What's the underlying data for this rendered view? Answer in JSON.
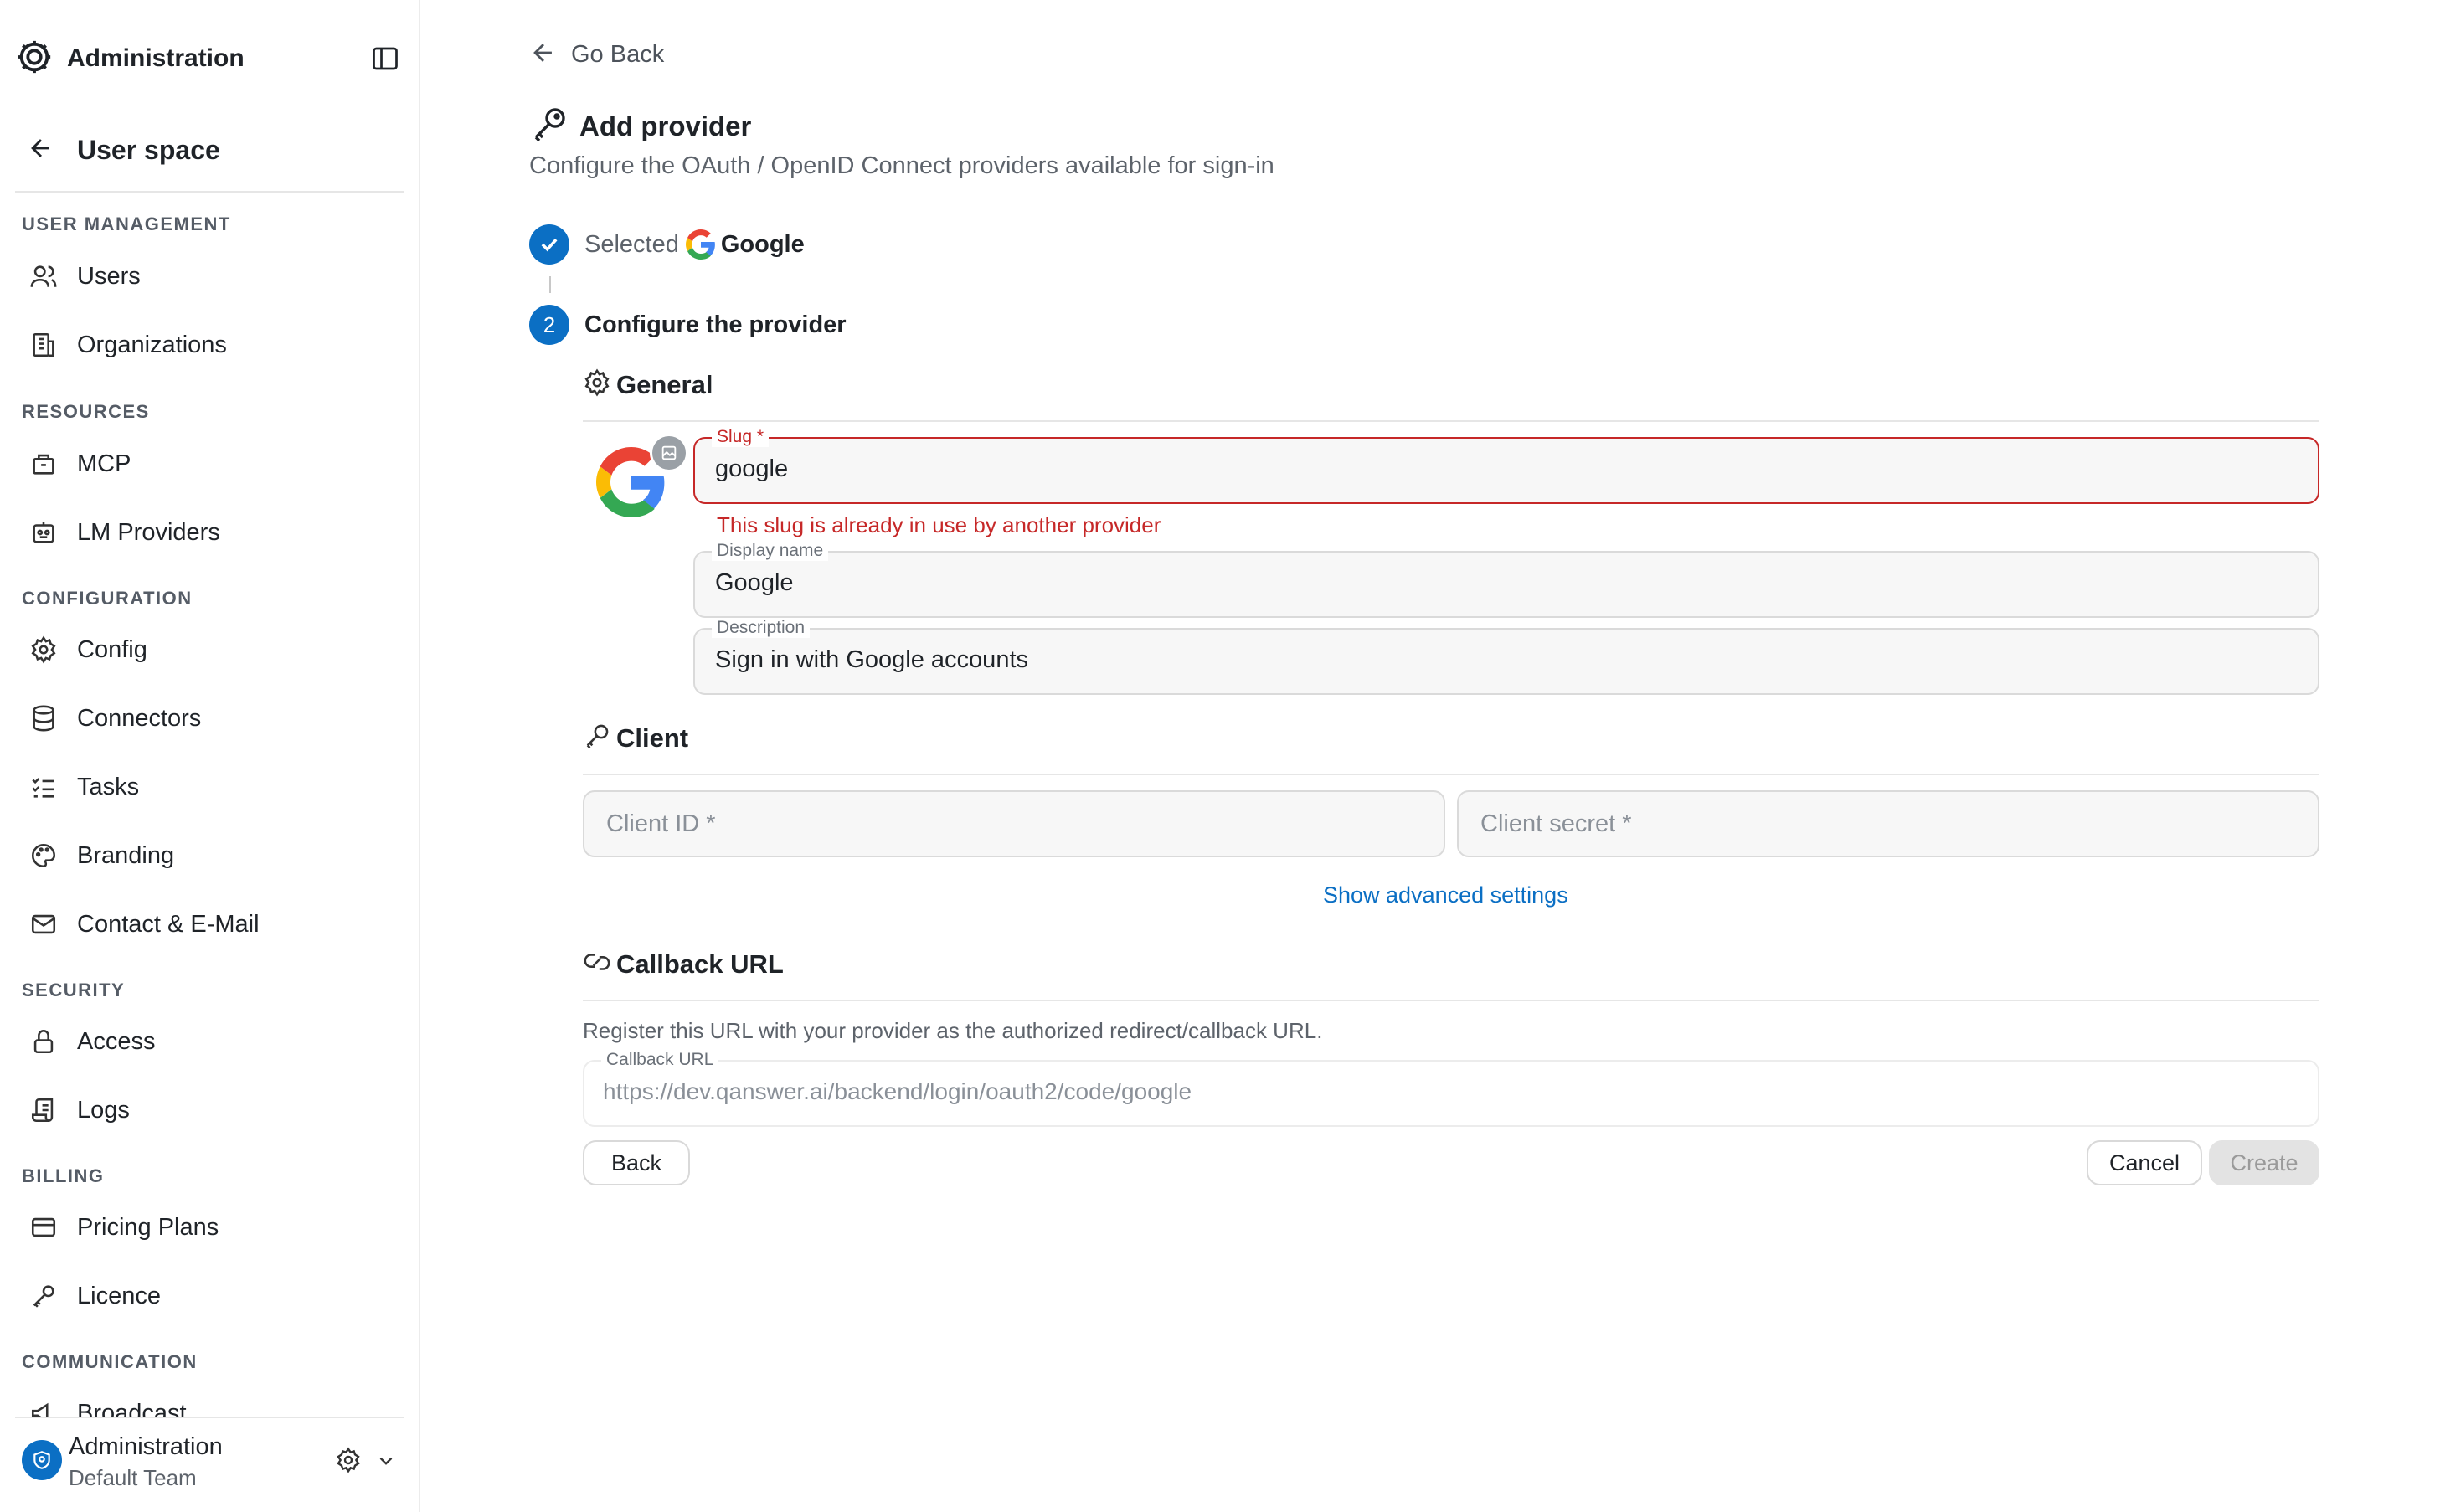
{
  "sidebar": {
    "title": "Administration",
    "back_label": "User space",
    "sections": {
      "user_management": "USER MANAGEMENT",
      "resources": "RESOURCES",
      "configuration": "CONFIGURATION",
      "security": "SECURITY",
      "billing": "BILLING",
      "communication": "COMMUNICATION"
    },
    "items": {
      "users": "Users",
      "organizations": "Organizations",
      "mcp": "MCP",
      "lm_providers": "LM Providers",
      "config": "Config",
      "connectors": "Connectors",
      "tasks": "Tasks",
      "branding": "Branding",
      "contact": "Contact & E-Mail",
      "access": "Access",
      "logs": "Logs",
      "pricing": "Pricing Plans",
      "licence": "Licence",
      "broadcast": "Broadcast"
    },
    "footer": {
      "name": "Administration",
      "team": "Default Team"
    }
  },
  "main": {
    "go_back": "Go Back",
    "title": "Add provider",
    "subtitle": "Configure the OAuth / OpenID Connect providers available for sign-in",
    "steps": {
      "selected_label": "Selected",
      "selected_provider": "Google",
      "step2_number": "2",
      "step2_label": "Configure the provider"
    },
    "general": {
      "title": "General",
      "slug_label": "Slug *",
      "slug_value": "google",
      "slug_error": "This slug is already in use by another provider",
      "display_name_label": "Display name",
      "display_name_value": "Google",
      "description_label": "Description",
      "description_value": "Sign in with Google accounts"
    },
    "client": {
      "title": "Client",
      "client_id_placeholder": "Client ID *",
      "client_secret_placeholder": "Client secret *",
      "advanced_link": "Show advanced settings"
    },
    "callback": {
      "title": "Callback URL",
      "description": "Register this URL with your provider as the authorized redirect/callback URL.",
      "field_label": "Callback URL",
      "url": "https://dev.qanswer.ai/backend/login/oauth2/code/google"
    },
    "buttons": {
      "back": "Back",
      "cancel": "Cancel",
      "create": "Create"
    }
  },
  "colors": {
    "accent": "#0b6fc4",
    "error": "#c62828"
  }
}
